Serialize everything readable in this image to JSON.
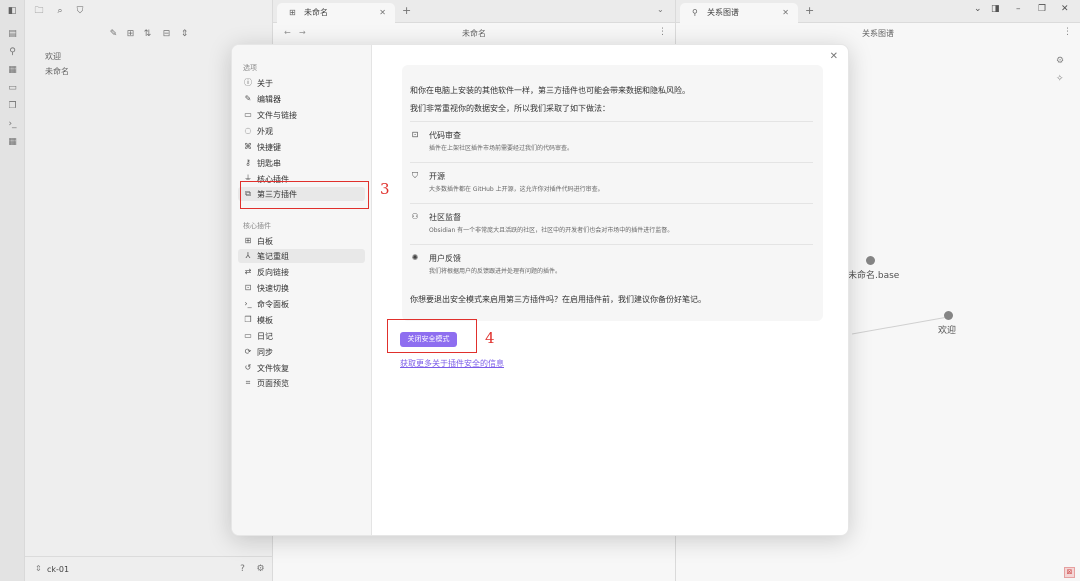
{
  "left_panel": {
    "files": [
      "欢迎",
      "未命名"
    ],
    "vault_name": "ck-01"
  },
  "tabs": {
    "middle": {
      "label": "未命名",
      "header_title": "未命名"
    },
    "right": {
      "label": "关系图谱",
      "header_title": "关系图谱"
    }
  },
  "graph": {
    "nodes": [
      {
        "label": "未命名.base"
      },
      {
        "label": "欢迎"
      }
    ]
  },
  "settings": {
    "options_heading": "选项",
    "options_items": [
      {
        "label": "关于",
        "icon": "info-icon"
      },
      {
        "label": "编辑器",
        "icon": "pencil-icon"
      },
      {
        "label": "文件与链接",
        "icon": "folder-icon"
      },
      {
        "label": "外观",
        "icon": "palette-icon"
      },
      {
        "label": "快捷键",
        "icon": "command-icon"
      },
      {
        "label": "钥匙串",
        "icon": "key-icon"
      },
      {
        "label": "核心插件",
        "icon": "plug-icon"
      },
      {
        "label": "第三方插件",
        "icon": "puzzle-icon"
      }
    ],
    "core_heading": "核心插件",
    "core_items": [
      {
        "label": "白板",
        "icon": "canvas-icon"
      },
      {
        "label": "笔记重组",
        "icon": "merge-icon"
      },
      {
        "label": "反向链接",
        "icon": "backlink-icon"
      },
      {
        "label": "快速切换",
        "icon": "switch-icon"
      },
      {
        "label": "命令面板",
        "icon": "terminal-icon"
      },
      {
        "label": "模板",
        "icon": "template-icon"
      },
      {
        "label": "日记",
        "icon": "calendar-icon"
      },
      {
        "label": "同步",
        "icon": "sync-icon"
      },
      {
        "label": "文件恢复",
        "icon": "history-icon"
      },
      {
        "label": "页面预览",
        "icon": "preview-icon"
      }
    ]
  },
  "safety": {
    "intro_1": "和你在电脑上安装的其他软件一样，第三方插件也可能会带来数据和隐私风险。",
    "intro_2": "我们非常重视你的数据安全，所以我们采取了如下做法：",
    "features": [
      {
        "icon": "code-review-icon",
        "title": "代码审查",
        "desc": "插件在上架社区插件市场前需要经过我们的代码审查。"
      },
      {
        "icon": "github-icon",
        "title": "开源",
        "desc": "大多数插件都在 GitHub 上开源，这允许你对插件代码进行审查。"
      },
      {
        "icon": "users-icon",
        "title": "社区监督",
        "desc": "Obsidian 有一个非常庞大且活跃的社区，社区中的开发者们也会对市场中的插件进行监督。"
      },
      {
        "icon": "bug-icon",
        "title": "用户反馈",
        "desc": "我们将根据用户的反馈跟进并处理有问题的插件。"
      }
    ],
    "question": "你想要退出安全模式来启用第三方插件吗？在启用插件前，我们建议你备份好笔记。",
    "button_label": "关闭安全模式",
    "link_label": "获取更多关于插件安全的信息"
  },
  "annotations": {
    "step_3": "3",
    "step_4": "4"
  },
  "colors": {
    "accent": "#8e6ef0",
    "annotation": "#e0302c"
  }
}
